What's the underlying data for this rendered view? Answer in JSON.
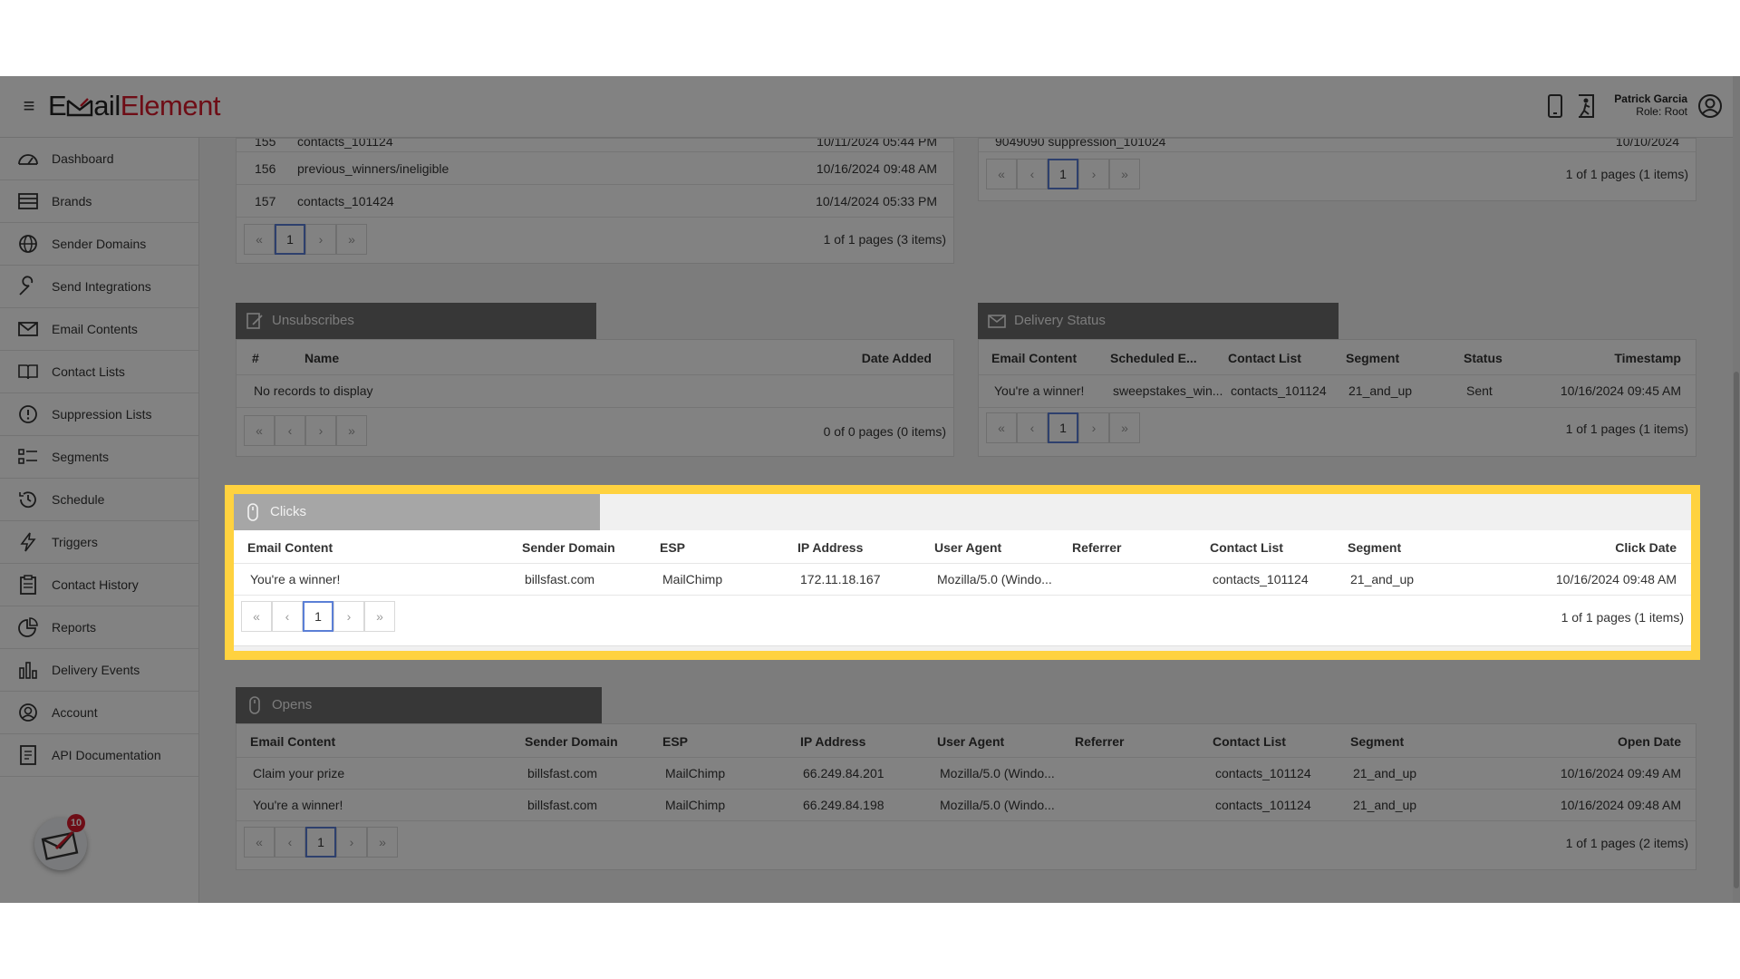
{
  "header": {
    "logo_prefix": "E",
    "logo_mid": "ail",
    "logo_suffix": "Element",
    "user_name": "Patrick Garcia",
    "user_role": "Role: Root"
  },
  "sidebar": {
    "items": [
      {
        "label": "Dashboard",
        "icon": "dashboard-icon"
      },
      {
        "label": "Brands",
        "icon": "brands-icon"
      },
      {
        "label": "Sender Domains",
        "icon": "globe-icon"
      },
      {
        "label": "Send Integrations",
        "icon": "wrench-icon"
      },
      {
        "label": "Email Contents",
        "icon": "envelope-icon"
      },
      {
        "label": "Contact Lists",
        "icon": "book-icon"
      },
      {
        "label": "Suppression Lists",
        "icon": "exclamation-icon"
      },
      {
        "label": "Segments",
        "icon": "segments-icon"
      },
      {
        "label": "Schedule",
        "icon": "clock-icon"
      },
      {
        "label": "Triggers",
        "icon": "lightning-icon"
      },
      {
        "label": "Contact History",
        "icon": "clipboard-icon"
      },
      {
        "label": "Reports",
        "icon": "pie-chart-icon"
      },
      {
        "label": "Delivery Events",
        "icon": "bar-chart-icon"
      },
      {
        "label": "Account",
        "icon": "user-circle-icon"
      },
      {
        "label": "API Documentation",
        "icon": "document-icon"
      }
    ],
    "mail_badge_count": "10"
  },
  "top_left_panel": {
    "rows": [
      {
        "num": "155",
        "name": "contacts_101124",
        "date": "10/11/2024 05:44 PM"
      },
      {
        "num": "156",
        "name": "previous_winners/ineligible",
        "date": "10/16/2024 09:48 AM"
      },
      {
        "num": "157",
        "name": "contacts_101424",
        "date": "10/14/2024 05:33 PM"
      }
    ],
    "page": "1",
    "page_info": "1 of 1 pages (3 items)"
  },
  "top_right_panel": {
    "rows": [
      {
        "left": "9049090 suppression_101024",
        "right": "10/10/2024"
      }
    ],
    "page": "1",
    "page_info": "1 of 1 pages (1 items)"
  },
  "unsubscribes": {
    "title": "Unsubscribes",
    "headers": {
      "num": "#",
      "name": "Name",
      "date": "Date Added"
    },
    "empty": "No records to display",
    "page_info": "0 of 0 pages (0 items)"
  },
  "delivery_status": {
    "title": "Delivery Status",
    "headers": [
      "Email Content",
      "Scheduled E...",
      "Contact List",
      "Segment",
      "Status",
      "Timestamp"
    ],
    "rows": [
      [
        "You're a winner!",
        "sweepstakes_win...",
        "contacts_101124",
        "21_and_up",
        "Sent",
        "10/16/2024 09:45 AM"
      ]
    ],
    "page": "1",
    "page_info": "1 of 1 pages (1 items)"
  },
  "clicks": {
    "title": "Clicks",
    "headers": [
      "Email Content",
      "Sender Domain",
      "ESP",
      "IP Address",
      "User Agent",
      "Referrer",
      "Contact List",
      "Segment",
      "Click Date"
    ],
    "rows": [
      [
        "You're a winner!",
        "billsfast.com",
        "MailChimp",
        "172.11.18.167",
        "Mozilla/5.0 (Windo...",
        "",
        "contacts_101124",
        "21_and_up",
        "10/16/2024 09:48 AM"
      ]
    ],
    "page": "1",
    "page_info": "1 of 1 pages (1 items)"
  },
  "opens": {
    "title": "Opens",
    "headers": [
      "Email Content",
      "Sender Domain",
      "ESP",
      "IP Address",
      "User Agent",
      "Referrer",
      "Contact List",
      "Segment",
      "Open Date"
    ],
    "rows": [
      [
        "Claim your prize",
        "billsfast.com",
        "MailChimp",
        "66.249.84.201",
        "Mozilla/5.0 (Windo...",
        "",
        "contacts_101124",
        "21_and_up",
        "10/16/2024 09:49 AM"
      ],
      [
        "You're a winner!",
        "billsfast.com",
        "MailChimp",
        "66.249.84.198",
        "Mozilla/5.0 (Windo...",
        "",
        "contacts_101124",
        "21_and_up",
        "10/16/2024 09:48 AM"
      ]
    ],
    "page": "1",
    "page_info": "1 of 1 pages (2 items)"
  },
  "pager_glyphs": {
    "first": "«",
    "prev": "‹",
    "next": "›",
    "last": "»"
  },
  "colors": {
    "accent": "#d81b2c",
    "highlight": "#ffd23f",
    "active_page": "#5b7fd6"
  }
}
